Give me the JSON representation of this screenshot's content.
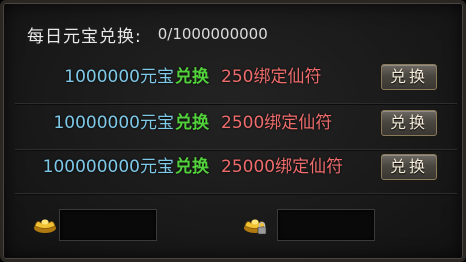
{
  "header": {
    "label": "每日元宝兑换:",
    "progress": "0/1000000000"
  },
  "rows": [
    {
      "amount": "1000000元宝",
      "exchange": "兑换",
      "reward": "250绑定仙符",
      "button": "兑换"
    },
    {
      "amount": "10000000元宝",
      "exchange": "兑换",
      "reward": "2500绑定仙符",
      "button": "兑换"
    },
    {
      "amount": "100000000元宝",
      "exchange": "兑换",
      "reward": "25000绑定仙符",
      "button": "兑换"
    }
  ],
  "footer": {
    "left_icon": "gold-ingot-icon",
    "right_icon": "locked-gold-ingot-icon",
    "left_value": "",
    "right_value": ""
  },
  "colors": {
    "amount": "#7ec8e8",
    "exchange": "#52d13c",
    "reward": "#ee6c6c"
  }
}
